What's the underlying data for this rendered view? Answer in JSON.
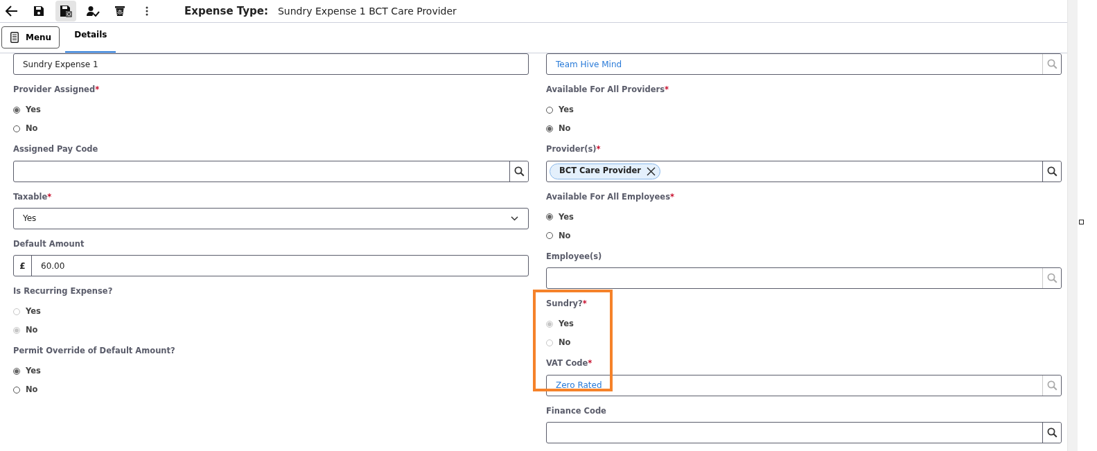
{
  "toolbar": {
    "buttons": [
      {
        "kind": "back"
      },
      {
        "kind": "save"
      },
      {
        "kind": "save-close",
        "hovered": true
      },
      {
        "kind": "person-check"
      },
      {
        "kind": "delete"
      },
      {
        "kind": "more"
      }
    ],
    "title_label": "Expense Type:",
    "title_value": "Sundry Expense 1 BCT Care Provider"
  },
  "menu_button": {
    "label": "Menu"
  },
  "tabs": [
    {
      "label": "Details",
      "selected": true
    }
  ],
  "columns": [
    [
      {
        "kind": "text",
        "value": "Sundry Expense 1",
        "highlighted": false
      },
      {
        "kind": "radio",
        "label": "Provider Assigned",
        "required_mark": "*",
        "disabled": false,
        "highlighted": false,
        "options": [
          {
            "label": "Yes",
            "selected": true
          },
          {
            "label": "No",
            "selected": false
          }
        ]
      },
      {
        "kind": "lookup",
        "label": "Assigned Pay Code",
        "search_enabled": true,
        "highlighted": false
      },
      {
        "kind": "select",
        "label": "Taxable",
        "required_mark": "*",
        "value": "Yes",
        "highlighted": false
      },
      {
        "kind": "currency",
        "label": "Default Amount",
        "symbol": "£",
        "value": "60.00",
        "highlighted": false
      },
      {
        "kind": "radio",
        "label": "Is Recurring Expense?",
        "disabled": true,
        "highlighted": false,
        "options": [
          {
            "label": "Yes",
            "selected": false
          },
          {
            "label": "No",
            "selected": true
          }
        ]
      },
      {
        "kind": "radio",
        "label": "Permit Override of Default Amount?",
        "disabled": false,
        "highlighted": false,
        "options": [
          {
            "label": "Yes",
            "selected": true
          },
          {
            "label": "No",
            "selected": false
          }
        ]
      }
    ],
    [
      {
        "kind": "lookup",
        "value": "Team Hive Mind",
        "search_enabled": false,
        "highlighted": false
      },
      {
        "kind": "radio",
        "label": "Available For All Providers",
        "required_mark": "*",
        "disabled": false,
        "highlighted": false,
        "options": [
          {
            "label": "Yes",
            "selected": false
          },
          {
            "label": "No",
            "selected": true
          }
        ]
      },
      {
        "kind": "tags",
        "label": "Provider(s)",
        "required_mark": "*",
        "search_enabled": true,
        "highlighted": false,
        "tags": [
          {
            "label": "BCT Care Provider"
          }
        ]
      },
      {
        "kind": "radio",
        "label": "Available For All Employees",
        "required_mark": "*",
        "disabled": false,
        "highlighted": false,
        "options": [
          {
            "label": "Yes",
            "selected": true
          },
          {
            "label": "No",
            "selected": false
          }
        ]
      },
      {
        "kind": "lookup",
        "label": "Employee(s)",
        "search_enabled": false,
        "highlighted": false
      },
      {
        "kind": "radio",
        "label": "Sundry?",
        "required_mark": "*",
        "disabled": true,
        "highlighted": true,
        "options": [
          {
            "label": "Yes",
            "selected": true
          },
          {
            "label": "No",
            "selected": false
          }
        ]
      },
      {
        "kind": "lookup",
        "label": "VAT Code",
        "required_mark": "*",
        "value": "Zero Rated",
        "search_enabled": false,
        "highlighted": true
      },
      {
        "kind": "lookup",
        "label": "Finance Code",
        "search_enabled": true,
        "highlighted": false
      }
    ]
  ]
}
